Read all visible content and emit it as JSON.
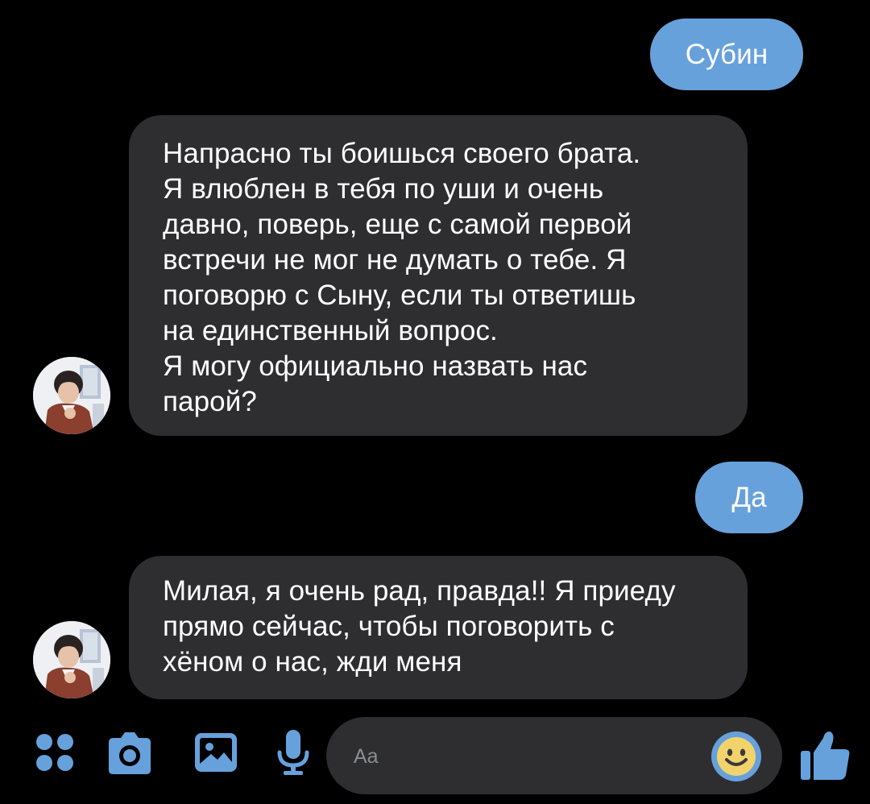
{
  "colors": {
    "background": "#000000",
    "outgoing_bubble": "#67a1dc",
    "incoming_bubble": "#2e2e31",
    "accent": "#67a1dc",
    "emoji_yellow": "#f2d36b"
  },
  "messages": [
    {
      "direction": "out",
      "text": "Субин"
    },
    {
      "direction": "in",
      "avatar": "contact-avatar",
      "text": "Напрасно ты боишься своего брата.\nЯ влюблен в тебя по уши и очень\nдавно, поверь, еще с самой первой\nвстречи не мог не думать о тебе. Я\nпоговорю с Сыну, если ты ответишь\nна единственный вопрос.\nЯ могу официально назвать нас\nпарой?"
    },
    {
      "direction": "out",
      "text": "Да"
    },
    {
      "direction": "in",
      "avatar": "contact-avatar",
      "text": "Милая, я очень рад, правда!! Я приеду\nпрямо сейчас, чтобы поговорить с\nхёном о нас, жди меня"
    }
  ],
  "composer": {
    "placeholder": "Aa",
    "icons": [
      "more-icon",
      "camera-icon",
      "gallery-icon",
      "microphone-icon",
      "emoji-icon",
      "thumbs-up-icon"
    ]
  }
}
